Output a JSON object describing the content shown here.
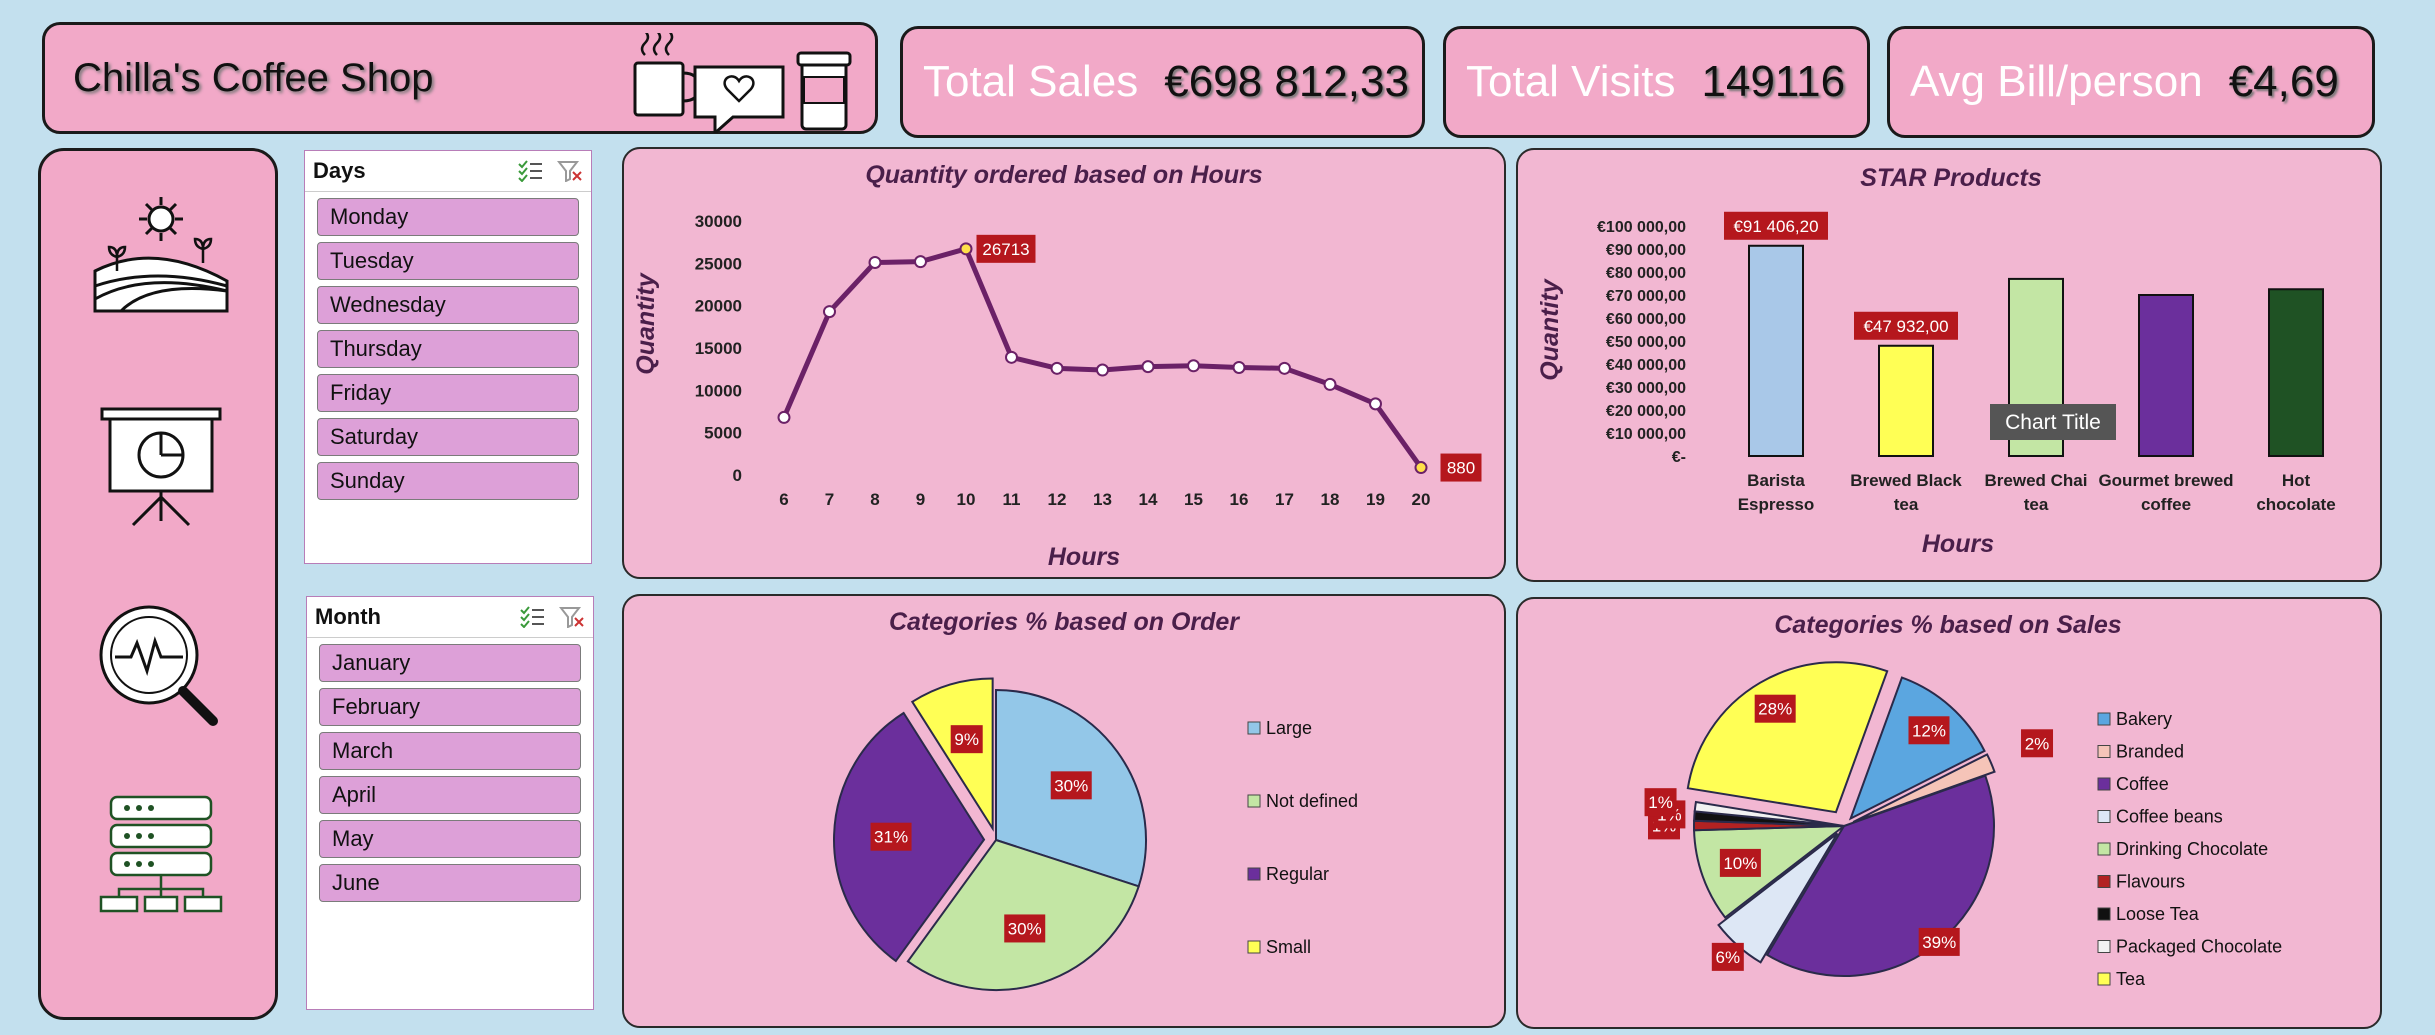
{
  "header": {
    "title": "Chilla's Coffee Shop"
  },
  "kpis": [
    {
      "label": "Total Sales",
      "value": "€698 812,33"
    },
    {
      "label": "Total Visits",
      "value": "149116"
    },
    {
      "label": "Avg Bill/person",
      "value": "€4,69"
    }
  ],
  "slicers": {
    "days": {
      "title": "Days",
      "items": [
        "Monday",
        "Tuesday",
        "Wednesday",
        "Thursday",
        "Friday",
        "Saturday",
        "Sunday"
      ]
    },
    "month": {
      "title": "Month",
      "items": [
        "January",
        "February",
        "March",
        "April",
        "May",
        "June"
      ]
    }
  },
  "sidebar": {
    "icons": [
      "farm-icon",
      "presentation-icon",
      "analytics-search-icon",
      "server-icon"
    ]
  },
  "chart_data": [
    {
      "type": "line",
      "title": "Quantity ordered based on Hours",
      "xlabel": "Hours",
      "ylabel": "Quantity",
      "x": [
        6,
        7,
        8,
        9,
        10,
        11,
        12,
        13,
        14,
        15,
        16,
        17,
        18,
        19,
        20
      ],
      "values": [
        6800,
        19300,
        25100,
        25200,
        26713,
        13900,
        12600,
        12400,
        12800,
        12900,
        12700,
        12600,
        10700,
        8400,
        880
      ],
      "ylim": [
        0,
        30000
      ],
      "yticks": [
        "30000",
        "25000",
        "20000",
        "15000",
        "10000",
        "5000",
        "0"
      ],
      "data_labels": [
        {
          "x": 10,
          "text": "26713"
        },
        {
          "x": 20,
          "text": "880"
        }
      ],
      "color": "#6b2167"
    },
    {
      "type": "bar",
      "title": "STAR Products",
      "xlabel": "Hours",
      "ylabel": "Quantity",
      "categories": [
        "Barista Espresso",
        "Brewed Black tea",
        "Brewed Chai tea",
        "Gourmet brewed coffee",
        "Hot chocolate"
      ],
      "values": [
        91406.2,
        47932.0,
        77000,
        70000,
        72500
      ],
      "colors": [
        "#a9c8e8",
        "#ffff55",
        "#c3e6a4",
        "#6b2f9c",
        "#1f5224"
      ],
      "ylim": [
        0,
        100000
      ],
      "yticks": [
        "€100 000,00",
        "€90 000,00",
        "€80 000,00",
        "€70 000,00",
        "€60 000,00",
        "€50 000,00",
        "€40 000,00",
        "€30 000,00",
        "€20 000,00",
        "€10 000,00",
        "€-"
      ],
      "data_labels": [
        {
          "i": 0,
          "text": "€91 406,20"
        },
        {
          "i": 1,
          "text": "€47 932,00"
        }
      ],
      "tooltip": "Chart Title"
    },
    {
      "type": "pie",
      "title": "Categories % based on Order",
      "labels": [
        "Large",
        "Not defined",
        "Regular",
        "Small"
      ],
      "values": [
        30,
        30,
        31,
        9
      ],
      "colors": [
        "#93c7e8",
        "#c3e6a4",
        "#6b2f9c",
        "#ffff55"
      ],
      "pct_labels": [
        "30%",
        "30%",
        "31%",
        "9%"
      ]
    },
    {
      "type": "pie",
      "title": "Categories % based on Sales",
      "labels": [
        "Bakery",
        "Branded",
        "Coffee",
        "Coffee beans",
        "Drinking Chocolate",
        "Flavours",
        "Loose Tea",
        "Packaged Chocolate",
        "Tea"
      ],
      "values": [
        12,
        2,
        39,
        6,
        10,
        1,
        1,
        1,
        28
      ],
      "colors": [
        "#5ba6e0",
        "#f5c4b8",
        "#6b2f9c",
        "#dde7f5",
        "#c3e6a4",
        "#b22222",
        "#111111",
        "#f2f2f2",
        "#ffff55"
      ],
      "pct_labels": [
        "12%",
        "2%",
        "39%",
        "6%",
        "10%",
        "1%",
        "1%",
        "1%",
        "28%"
      ]
    }
  ]
}
